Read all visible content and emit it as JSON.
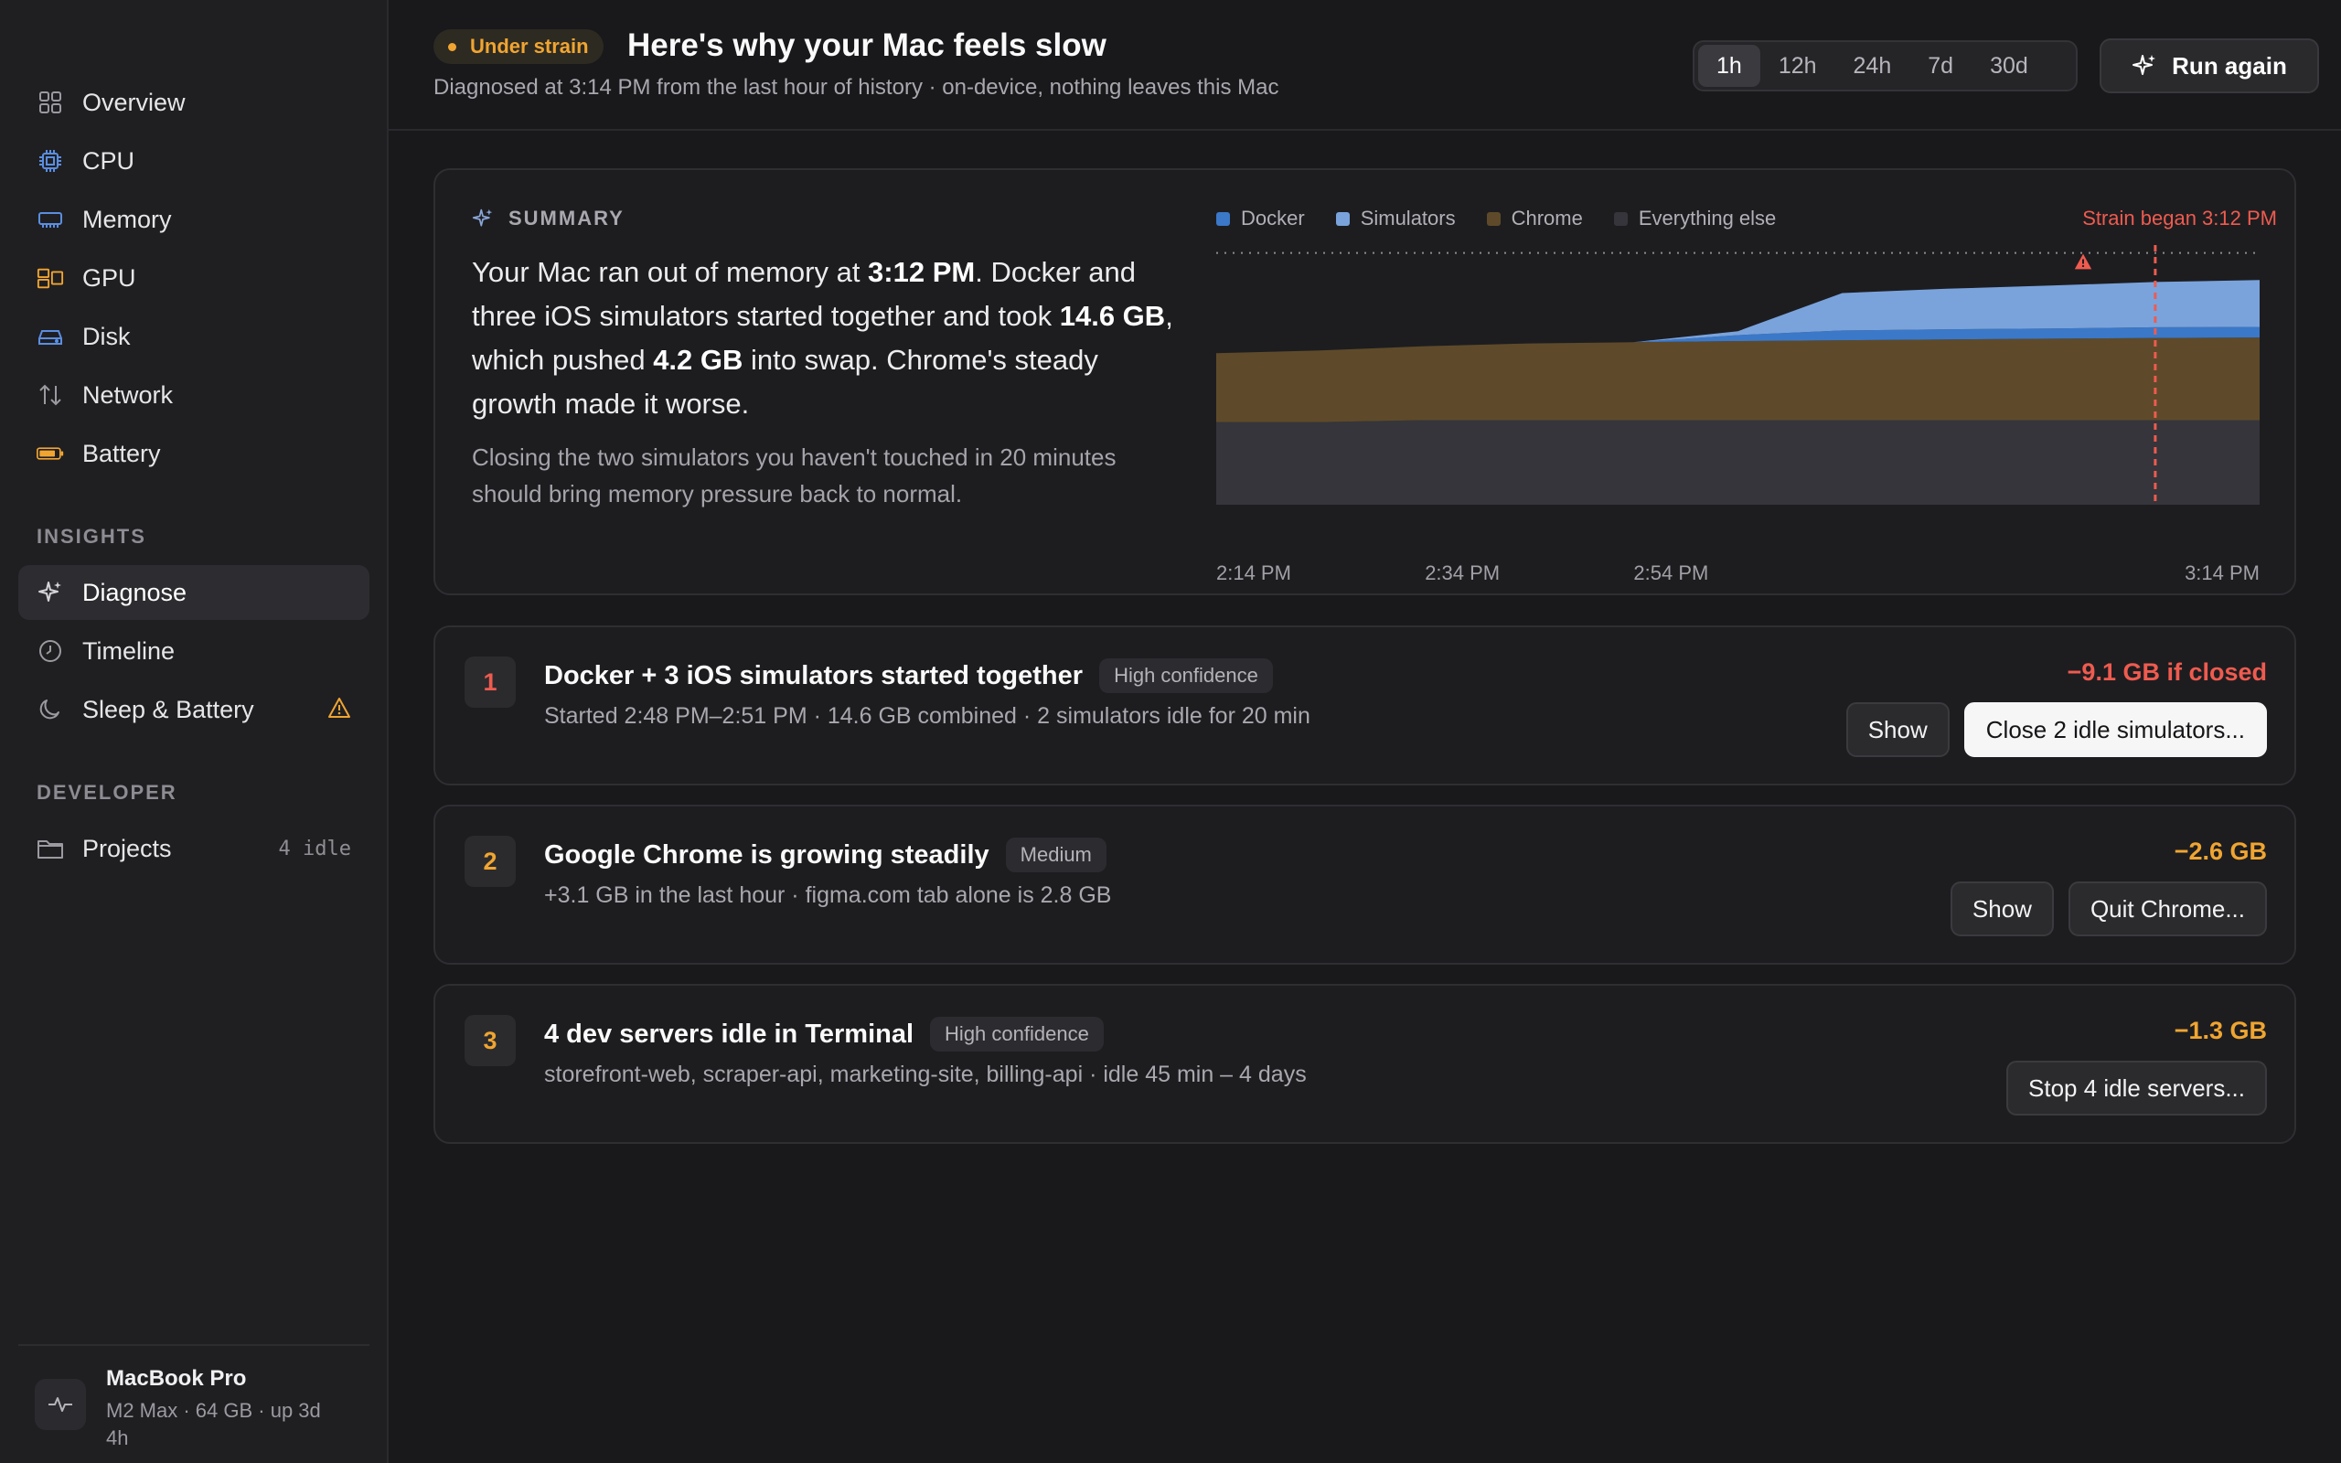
{
  "sidebar": {
    "nav": [
      {
        "label": "Overview",
        "icon": "grid-icon"
      },
      {
        "label": "CPU",
        "icon": "cpu-icon"
      },
      {
        "label": "Memory",
        "icon": "memory-icon"
      },
      {
        "label": "GPU",
        "icon": "gpu-icon"
      },
      {
        "label": "Disk",
        "icon": "disk-icon"
      },
      {
        "label": "Network",
        "icon": "network-arrows-icon"
      },
      {
        "label": "Battery",
        "icon": "battery-icon"
      }
    ],
    "insights_heading": "INSIGHTS",
    "insights": [
      {
        "label": "Diagnose",
        "icon": "sparkle-icon",
        "active": true
      },
      {
        "label": "Timeline",
        "icon": "clock-icon"
      },
      {
        "label": "Sleep & Battery",
        "icon": "moon-icon",
        "warning": true
      }
    ],
    "developer_heading": "DEVELOPER",
    "developer": [
      {
        "label": "Projects",
        "icon": "folder-icon",
        "trail": "4 idle"
      }
    ],
    "device": {
      "name": "MacBook Pro",
      "spec": "M2 Max · 64 GB · up 3d 4h"
    }
  },
  "header": {
    "status_badge": "Under strain",
    "title": "Here's why your Mac feels slow",
    "subtitle": "Diagnosed at 3:14 PM from the last hour of history · on-device, nothing leaves this Mac",
    "ranges": [
      "1h",
      "12h",
      "24h",
      "7d",
      "30d"
    ],
    "active_range": "1h",
    "run_again": "Run again"
  },
  "summary": {
    "label": "SUMMARY",
    "text_parts": [
      {
        "t": "Your Mac ran out of memory at ",
        "b": false
      },
      {
        "t": "3:12 PM",
        "b": true
      },
      {
        "t": ". Docker and three iOS simulators started together and took ",
        "b": false
      },
      {
        "t": "14.6 GB",
        "b": true
      },
      {
        "t": ", which pushed ",
        "b": false
      },
      {
        "t": "4.2 GB",
        "b": true
      },
      {
        "t": " into swap. Chrome's steady growth made it worse.",
        "b": false
      }
    ],
    "recommendation": "Closing the two simulators you haven't touched in 20 minutes should bring memory pressure back to normal.",
    "strain_label": "Strain began 3:12 PM"
  },
  "chart_data": {
    "type": "area",
    "stacked": true,
    "x": [
      "2:14 PM",
      "2:24 PM",
      "2:34 PM",
      "2:44 PM",
      "2:54 PM",
      "2:58 PM",
      "3:00 PM",
      "3:04 PM",
      "3:08 PM",
      "3:12 PM",
      "3:14 PM"
    ],
    "xticks": [
      "2:14 PM",
      "2:34 PM",
      "2:54 PM",
      "3:14 PM"
    ],
    "series": [
      {
        "name": "Everything else",
        "color": "#35353b",
        "values": [
          21,
          21,
          21.5,
          21.5,
          21.5,
          21.5,
          21.5,
          21.5,
          21.5,
          21.5,
          21.5
        ]
      },
      {
        "name": "Chrome",
        "color": "#5e4a2a",
        "values": [
          17.5,
          18.2,
          18.8,
          19.5,
          19.8,
          20.1,
          20.3,
          20.5,
          20.7,
          20.9,
          21
        ]
      },
      {
        "name": "Docker",
        "color": "#3b78c8",
        "values": [
          0,
          0,
          0,
          0,
          0,
          1.5,
          2.5,
          2.6,
          2.6,
          2.7,
          2.7
        ]
      },
      {
        "name": "Simulators",
        "color": "#7aa3dc",
        "values": [
          0,
          0,
          0,
          0,
          0,
          1,
          9.5,
          10.3,
          10.9,
          11.5,
          11.9
        ]
      }
    ],
    "ylim": [
      0,
      66
    ],
    "capacity_line": 64,
    "strain_marker": "3:12 PM",
    "legend_position": "top-left"
  },
  "issues": [
    {
      "num": "1",
      "num_color": "#ef5b4f",
      "title": "Docker + 3 iOS simulators started together",
      "confidence": "High confidence",
      "desc": "Started 2:48 PM–2:51 PM · 14.6 GB combined · 2 simulators idle for 20 min",
      "impact": "−9.1 GB if closed",
      "impact_color": "#ef5b4f",
      "secondary": "Show",
      "primary": "Close 2 idle simulators..."
    },
    {
      "num": "2",
      "num_color": "#f0a531",
      "title": "Google Chrome is growing steadily",
      "confidence": "Medium",
      "desc": "+3.1 GB in the last hour · figma.com tab alone is 2.8 GB",
      "impact": "−2.6 GB",
      "impact_color": "#f0a531",
      "secondary": "Show",
      "primary": "Quit Chrome..."
    },
    {
      "num": "3",
      "num_color": "#f0a531",
      "title": "4 dev servers idle in Terminal",
      "confidence": "High confidence",
      "desc": "storefront-web, scraper-api, marketing-site, billing-api · idle 45 min – 4 days",
      "impact": "−1.3 GB",
      "impact_color": "#f0a531",
      "primary": "Stop 4 idle servers..."
    }
  ]
}
